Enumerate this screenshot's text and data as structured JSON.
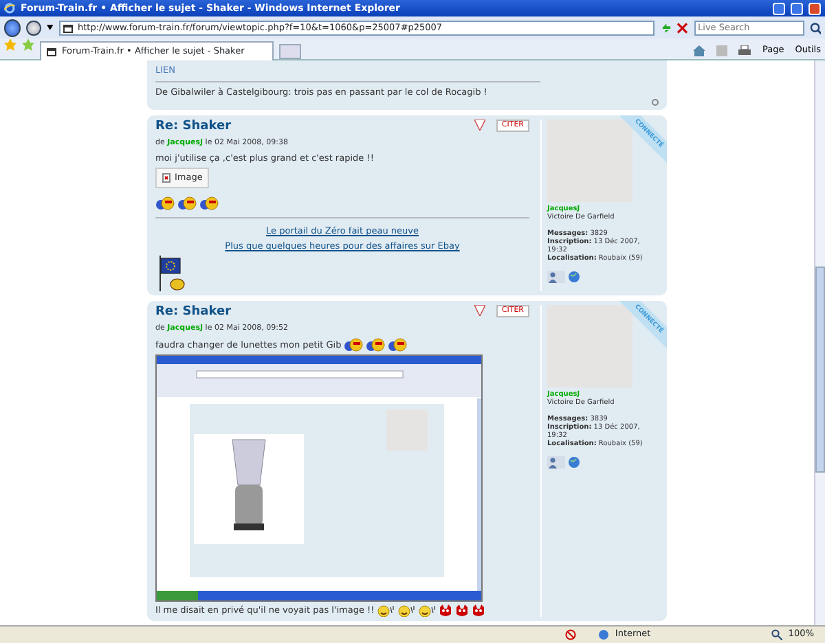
{
  "window": {
    "title": "Forum-Train.fr • Afficher le sujet - Shaker - Windows Internet Explorer"
  },
  "address_bar": {
    "url": "http://www.forum-train.fr/forum/viewtopic.php?f=10&t=1060&p=25007#p25007",
    "search_placeholder": "Live Search"
  },
  "tabs": [
    {
      "label": "Forum-Train.fr • Afficher le sujet - Shaker",
      "selected": true
    }
  ],
  "command_bar": {
    "page_menu": "Page",
    "tools_menu": "Outils"
  },
  "previous_post": {
    "link": "LIEN",
    "signature": "De Gibalwiler à Castelgibourg: trois pas en passant par le col de Rocagib !"
  },
  "posts": [
    {
      "title": "Re: Shaker",
      "by": "de",
      "author": "JacquesJ",
      "date": "le 02 Mai 2008, 09:38",
      "quote_button": "CITER",
      "online_label": "CONNECTÉ",
      "body": [
        {
          "kind": "text",
          "text": "moi j'utilise ça ,c'est plus grand et c'est rapide !!"
        },
        {
          "kind": "broken_image",
          "label": "Image"
        },
        {
          "kind": "smilies"
        }
      ],
      "signature": {
        "links": [
          "Le portail du Zéro fait peau neuve",
          "Plus que quelques heures pour des affaires sur Ebay"
        ]
      },
      "profile": {
        "name": "JacquesJ",
        "rank": "Victoire De Garfield",
        "stats": [
          {
            "label": "Messages:",
            "value": "3829"
          },
          {
            "label": "Inscription:",
            "value": "13 Déc 2007, 19:32"
          },
          {
            "label": "Localisation:",
            "value": "Roubaix (59)"
          }
        ]
      }
    },
    {
      "title": "Re: Shaker",
      "by": "de",
      "author": "JacquesJ",
      "date": "le 02 Mai 2008, 09:52",
      "quote_button": "CITER",
      "online_label": "CONNECTÉ",
      "body": [
        {
          "kind": "text_smilies",
          "text": "faudra changer de lunettes mon petit Gib"
        },
        {
          "kind": "screenshot"
        },
        {
          "kind": "text_angry",
          "text": "Il me disait en privé qu'il ne voyait pas l'image !!"
        }
      ],
      "profile": {
        "name": "JacquesJ",
        "rank": "Victoire De Garfield",
        "stats": [
          {
            "label": "Messages:",
            "value": "3839"
          },
          {
            "label": "Inscription:",
            "value": "13 Déc 2007, 19:32"
          },
          {
            "label": "Localisation:",
            "value": "Roubaix (59)"
          }
        ]
      }
    }
  ],
  "status_bar": {
    "zone": "Internet",
    "zoom": "100%"
  }
}
